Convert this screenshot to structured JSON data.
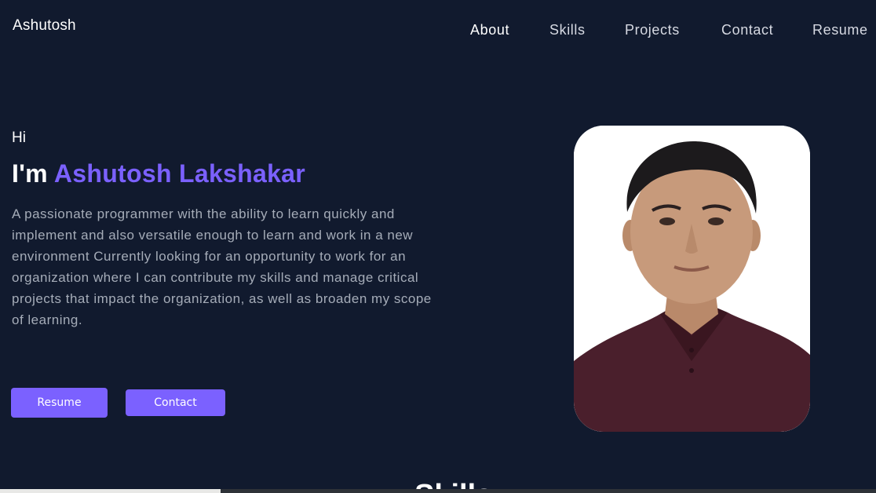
{
  "header": {
    "brand": "Ashutosh",
    "nav": {
      "about": "About",
      "skills": "Skills",
      "projects": "Projects",
      "contact": "Contact",
      "resume": "Resume"
    }
  },
  "hero": {
    "greeting": "Hi",
    "headline_prefix": "I'm ",
    "headline_name": "Ashutosh Lakshakar",
    "bio": "A passionate programmer with the ability to learn quickly and implement and also versatile enough to learn and work in a new environment Currently looking for an opportunity to work for an organization where I can contribute my skills and manage critical projects that impact the organization, as well as broaden my scope of learning.",
    "buttons": {
      "resume": "Resume",
      "contact": "Contact"
    }
  },
  "next_section": {
    "heading_partial": "Skills"
  },
  "colors": {
    "background": "#111a2e",
    "accent": "#7b61ff",
    "text": "#ffffff",
    "muted_text": "#a5acb8"
  }
}
